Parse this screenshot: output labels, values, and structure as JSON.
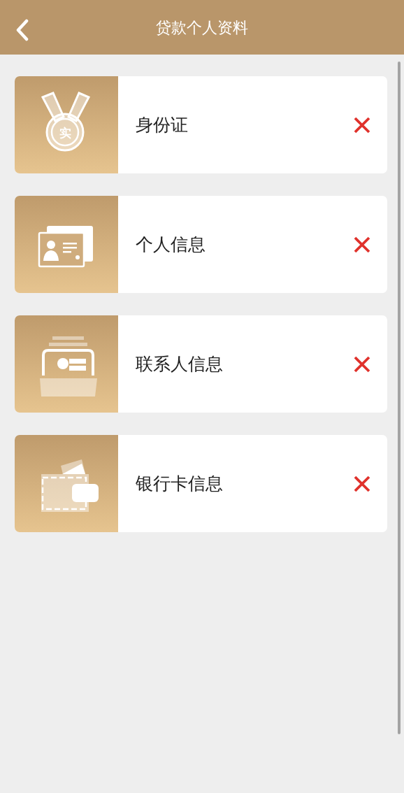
{
  "header": {
    "back_icon": true,
    "title": "贷款个人资料"
  },
  "items": [
    {
      "kind": "medal",
      "icon_text": "实",
      "label": "身份证",
      "completed": false
    },
    {
      "kind": "id-card",
      "label": "个人信息",
      "completed": false
    },
    {
      "kind": "contacts",
      "label": "联系人信息",
      "completed": false
    },
    {
      "kind": "wallet",
      "label": "银行卡信息",
      "completed": false
    }
  ]
}
